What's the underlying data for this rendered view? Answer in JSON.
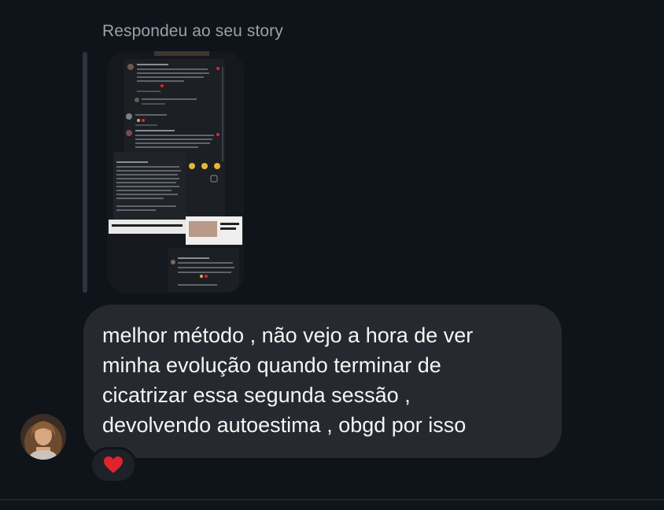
{
  "header": {
    "reply_label": "Respondeu ao seu story"
  },
  "story_preview": {
    "icon": "story-thumbnail",
    "caption": "agradeço a inesquecível oportunidade de ser paciente de vocês!"
  },
  "message": {
    "text": "melhor método , não vejo a hora de ver\nminha evolução quando terminar de\ncicatrizar essa segunda sessão ,\ndevolvendo autoestima , obgd por isso"
  },
  "sender": {
    "avatar_icon": "user-avatar"
  },
  "reaction": {
    "icon": "heart-icon",
    "color": "#e0242e"
  },
  "colors": {
    "background": "#0f141b",
    "bubble": "#262a30",
    "label": "#9aa0a6"
  }
}
